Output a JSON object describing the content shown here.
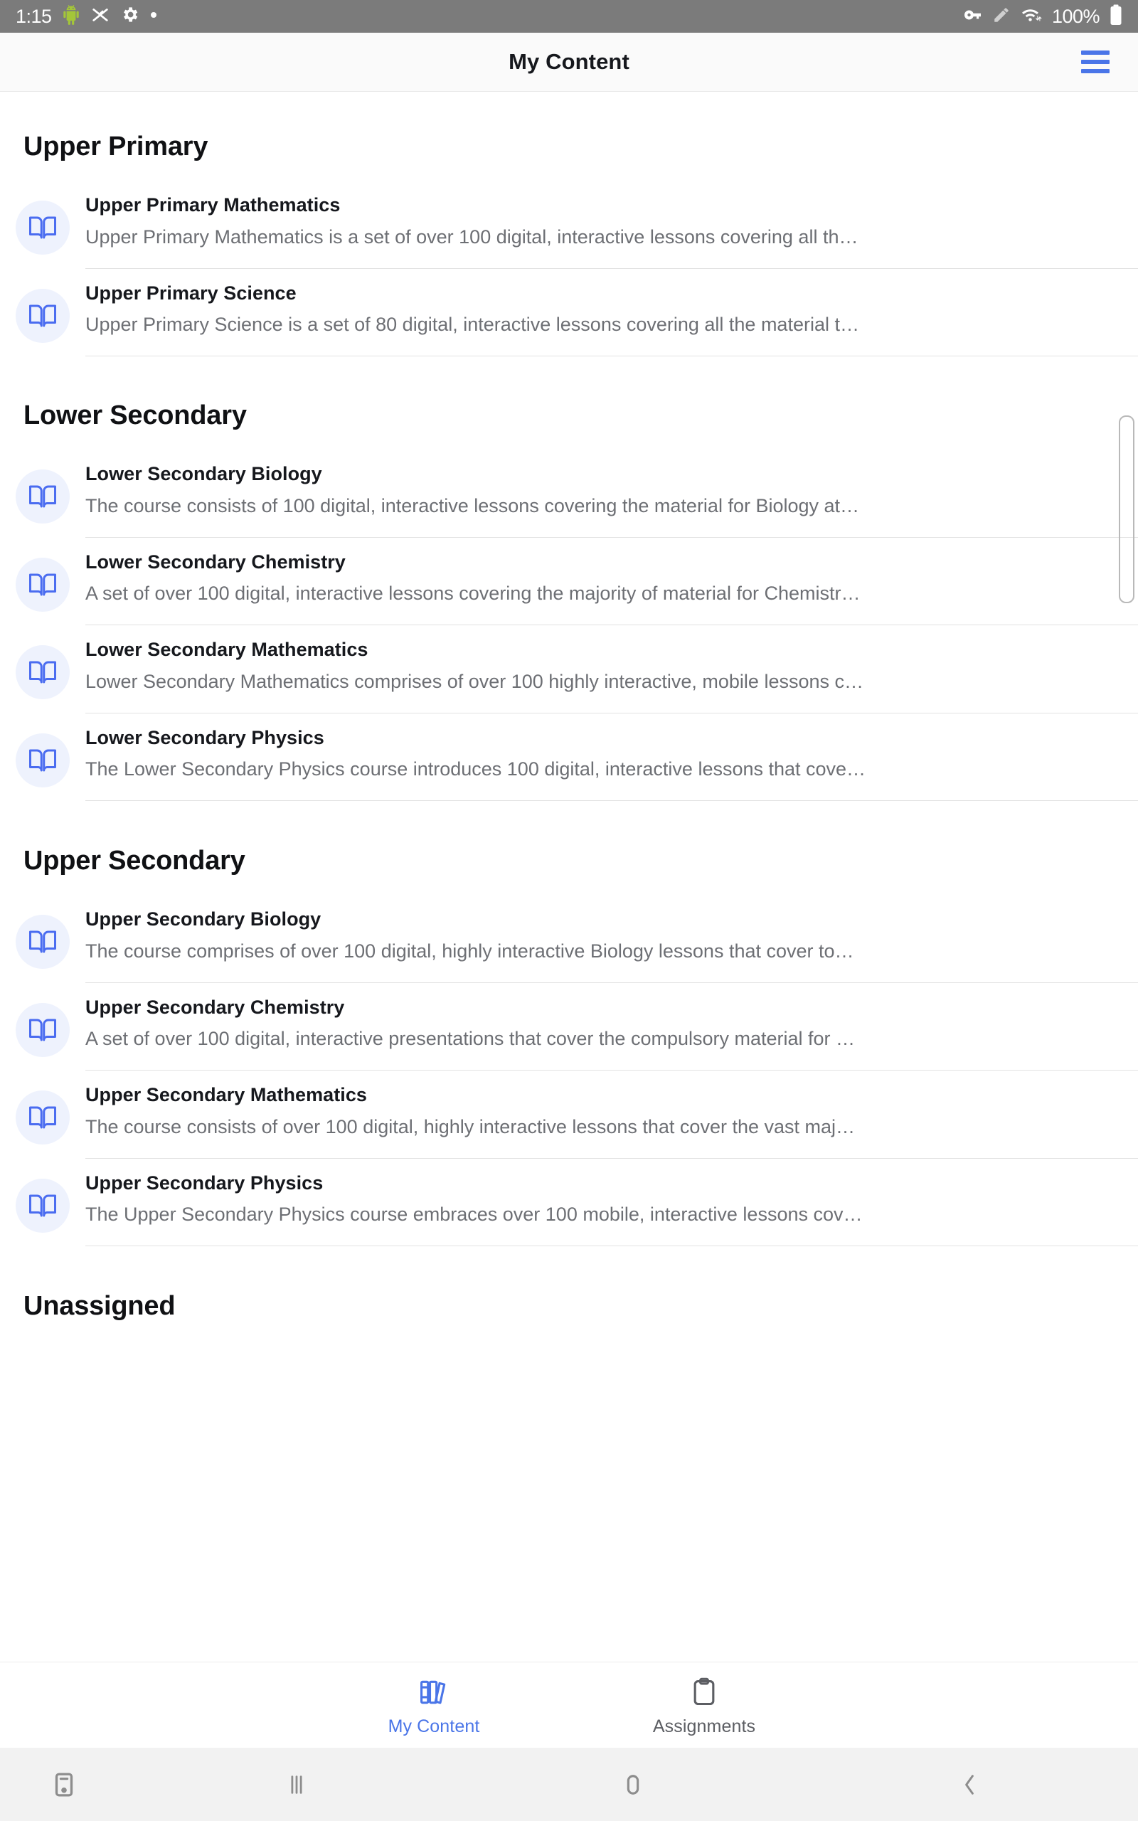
{
  "status_bar": {
    "time": "1:15",
    "battery_text": "100%",
    "left_icons": [
      "android-robot-icon",
      "screen-cast-off-icon",
      "gear-icon",
      "dot-icon"
    ],
    "right_icons": [
      "vpn-key-icon",
      "pencil-icon",
      "wifi-icon",
      "battery-icon"
    ]
  },
  "app_bar": {
    "title": "My Content",
    "menu_icon": "hamburger-menu-icon",
    "accent_color": "#4a75e8"
  },
  "sections": [
    {
      "title": "Upper Primary",
      "items": [
        {
          "icon": "open-book-icon",
          "title": "Upper Primary Mathematics",
          "description": "Upper Primary Mathematics is a set of over 100 digital, interactive lessons covering all th…"
        },
        {
          "icon": "open-book-icon",
          "title": "Upper Primary Science",
          "description": "Upper Primary Science is a set of 80 digital, interactive lessons covering all the material t…"
        }
      ]
    },
    {
      "title": "Lower Secondary",
      "items": [
        {
          "icon": "open-book-icon",
          "title": "Lower Secondary Biology",
          "description": "The course consists of 100 digital, interactive lessons covering the material for Biology at…"
        },
        {
          "icon": "open-book-icon",
          "title": "Lower Secondary Chemistry",
          "description": "A set of over 100 digital, interactive lessons covering the majority of material for Chemistr…"
        },
        {
          "icon": "open-book-icon",
          "title": "Lower Secondary Mathematics",
          "description": "Lower Secondary Mathematics comprises of over 100 highly interactive, mobile lessons c…"
        },
        {
          "icon": "open-book-icon",
          "title": "Lower Secondary Physics",
          "description": "The Lower Secondary Physics course introduces 100 digital, interactive lessons that cove…"
        }
      ]
    },
    {
      "title": "Upper Secondary",
      "items": [
        {
          "icon": "open-book-icon",
          "title": "Upper Secondary Biology",
          "description": "The course comprises of over 100 digital, highly interactive Biology lessons that cover to…"
        },
        {
          "icon": "open-book-icon",
          "title": "Upper Secondary Chemistry",
          "description": "A set of over 100 digital, interactive presentations that cover the compulsory material for …"
        },
        {
          "icon": "open-book-icon",
          "title": "Upper Secondary Mathematics",
          "description": "The course consists of over 100 digital, highly interactive lessons that cover the vast maj…"
        },
        {
          "icon": "open-book-icon",
          "title": "Upper Secondary Physics",
          "description": "The Upper Secondary Physics course embraces over 100 mobile, interactive lessons cov…"
        }
      ]
    },
    {
      "title": "Unassigned",
      "items": []
    }
  ],
  "tab_bar": {
    "tabs": [
      {
        "label": "My Content",
        "icon": "library-books-icon",
        "active": true
      },
      {
        "label": "Assignments",
        "icon": "clipboard-icon",
        "active": false
      }
    ]
  },
  "nav_bar": {
    "buttons": [
      "screenshot-icon",
      "recent-apps-icon",
      "home-icon",
      "back-icon"
    ]
  }
}
